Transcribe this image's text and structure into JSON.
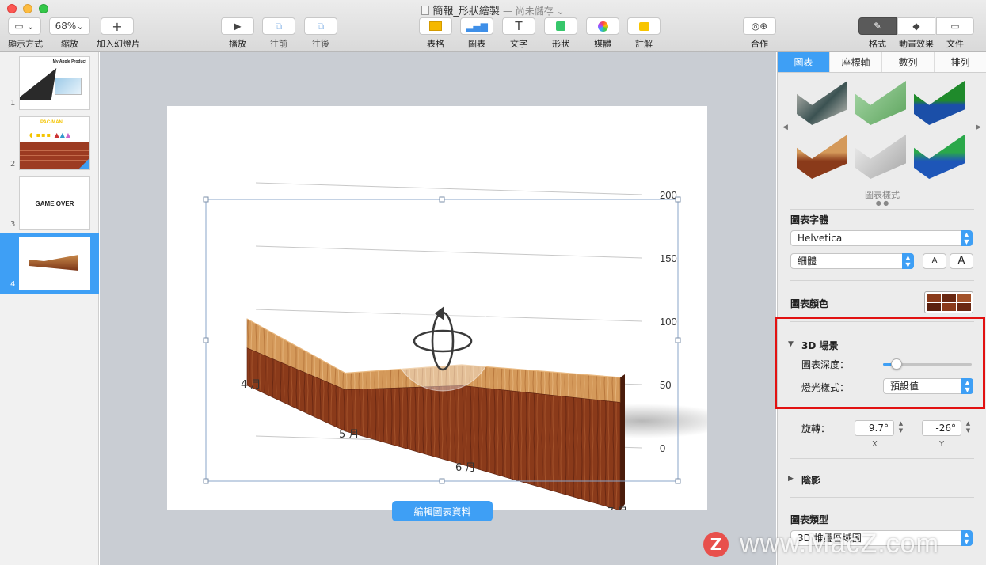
{
  "window": {
    "title": "簡報_形狀繪製",
    "status": "— 尚未儲存",
    "icon": "keynote-doc-icon"
  },
  "toolbar": {
    "view_label": "顯示方式",
    "zoom_value": "68%",
    "zoom_label": "縮放",
    "add_slide_label": "加入幻燈片",
    "play_label": "播放",
    "forward_label": "往前",
    "backward_label": "往後",
    "table_label": "表格",
    "chart_label": "圖表",
    "text_label": "文字",
    "shape_label": "形狀",
    "media_label": "媒體",
    "comment_label": "註解",
    "collab_label": "合作",
    "format_label": "格式",
    "animate_label": "動畫效果",
    "document_label": "文件"
  },
  "slides": [
    {
      "num": "1",
      "title": "My Apple Product"
    },
    {
      "num": "2",
      "title": "PAC-MAN"
    },
    {
      "num": "3",
      "title": "GAME OVER"
    },
    {
      "num": "4",
      "title": ""
    }
  ],
  "chart_data": {
    "type": "area",
    "style": "3d-wood",
    "categories": [
      "4 月",
      "5 月",
      "6 月",
      "7 月"
    ],
    "series": [
      {
        "values": [
          80,
          70,
          120,
          160
        ]
      },
      {
        "values": [
          45,
          50,
          95,
          130
        ]
      }
    ],
    "yticks": [
      "200",
      "150",
      "100",
      "50",
      "0"
    ],
    "ylim": [
      0,
      200
    ],
    "grid": true,
    "edit_button": "編輯圖表資料"
  },
  "inspector": {
    "tabs": [
      "圖表",
      "座標軸",
      "數列",
      "排列"
    ],
    "active_tab": "圖表",
    "chart_styles_label": "圖表樣式",
    "chart_font_label": "圖表字體",
    "font_family": "Helvetica",
    "font_weight": "細體",
    "font_smaller": "A",
    "font_larger": "A",
    "chart_colors_label": "圖表顏色",
    "scene_label": "3D 場景",
    "depth_label": "圖表深度：",
    "depth_value": 0.1,
    "lighting_label": "燈光樣式：",
    "lighting_value": "預設值",
    "rotation_label": "旋轉：",
    "rotation_x": "9.7°",
    "rotation_y": "-26°",
    "rotation_x_label": "X",
    "rotation_y_label": "Y",
    "shadow_label": "陰影",
    "chart_type_label": "圖表類型",
    "chart_type_value": "3D 堆疊區域圖"
  },
  "watermark": {
    "letter": "Z",
    "text": "www.MacZ.com"
  },
  "colors": {
    "accent": "#3E9FF5",
    "highlight": "#E21111",
    "wood_light": "#D49A5A",
    "wood_dark": "#8A3A1A"
  }
}
